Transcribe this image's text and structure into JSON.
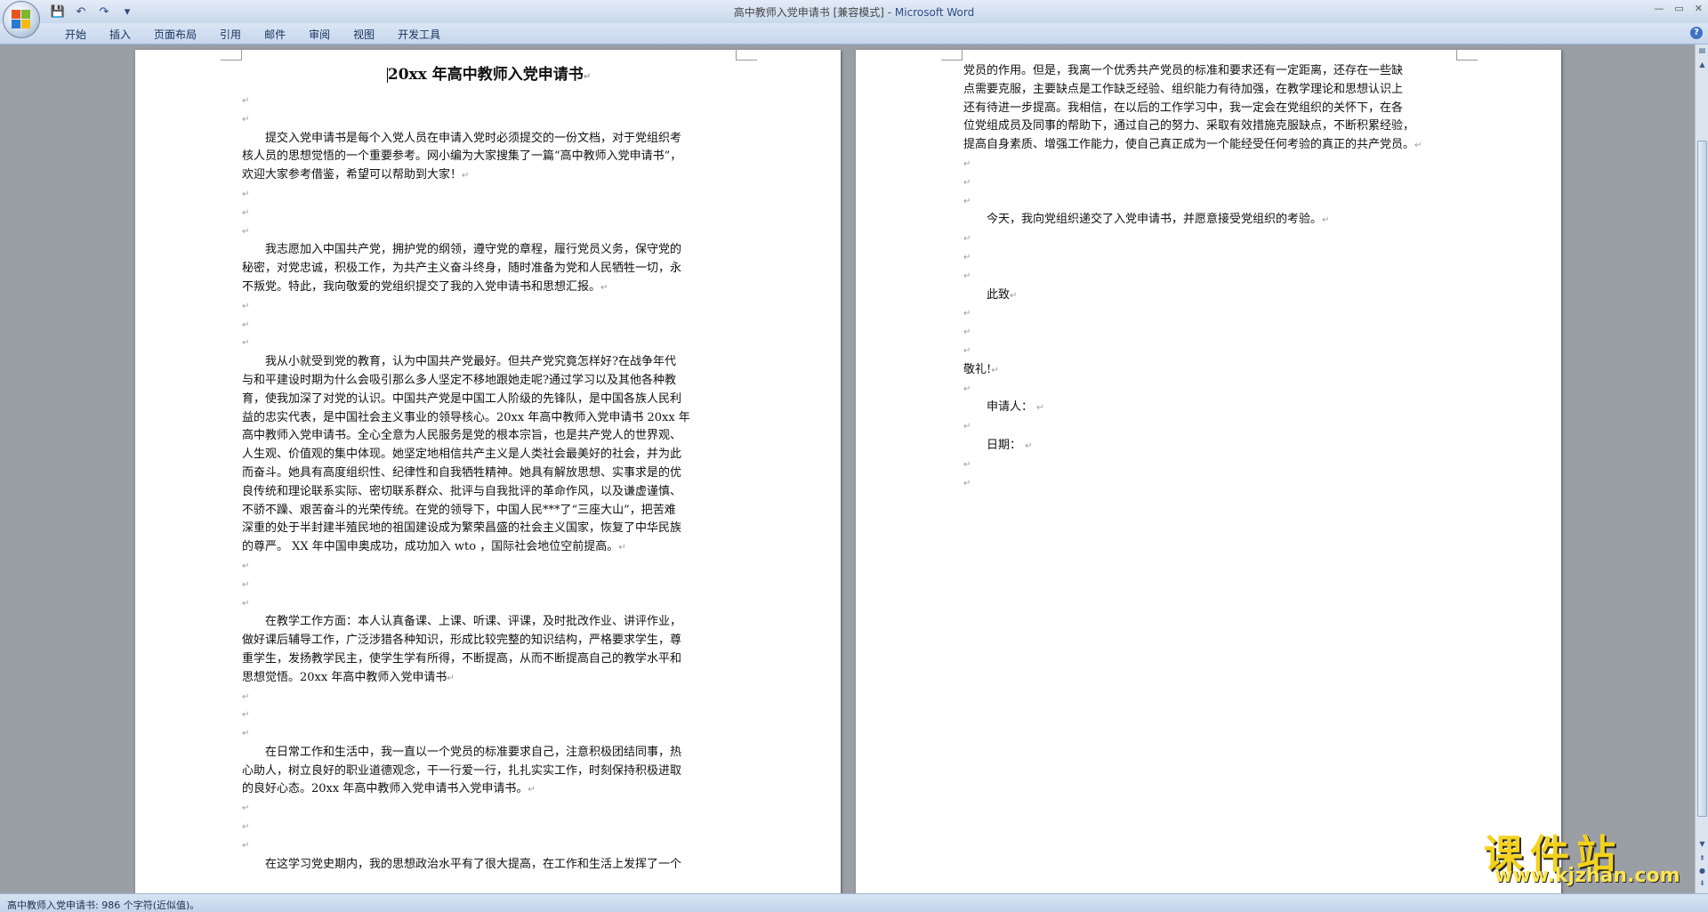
{
  "window": {
    "title": "高中教师入党申请书 [兼容模式] - ",
    "app_name": "Microsoft Word",
    "controls": [
      "—",
      "▭",
      "✕"
    ]
  },
  "quick_access": {
    "save": "💾",
    "undo": "↶",
    "redo": "↷",
    "customize": "▾"
  },
  "ribbon": {
    "tabs": [
      "开始",
      "插入",
      "页面布局",
      "引用",
      "邮件",
      "审阅",
      "视图",
      "开发工具"
    ],
    "help": "?"
  },
  "document": {
    "title": "20xx 年高中教师入党申请书",
    "pilcrow": "↵",
    "page1_paragraphs": [
      [
        "提交入党申请书是每个入党人员在申请入党时必须提交的一份文档，对于党组织考",
        "核人员的思想觉悟的一个重要参考。网小编为大家搜集了一篇“高中教师入党申请书”，",
        "欢迎大家参考借鉴，希望可以帮助到大家！"
      ],
      [
        "我志愿加入中国共产党，拥护党的纲领，遵守党的章程，履行党员义务，保守党的",
        "秘密，对党忠诚，积极工作，为共产主义奋斗终身，随时准备为党和人民牺牲一切，永",
        "不叛党。特此，我向敬爱的党组织提交了我的入党申请书和思想汇报。"
      ],
      [
        "我从小就受到党的教育，认为中国共产党最好。但共产党究竟怎样好?在战争年代",
        "与和平建设时期为什么会吸引那么多人坚定不移地跟她走呢?通过学习以及其他各种教",
        "育，使我加深了对党的认识。中国共产党是中国工人阶级的先锋队，是中国各族人民利",
        "益的忠实代表，是中国社会主义事业的领导核心。20xx 年高中教师入党申请书 20xx 年",
        "高中教师入党申请书。全心全意为人民服务是党的根本宗旨，也是共产党人的世界观、",
        "人生观、价值观的集中体现。她坚定地相信共产主义是人类社会最美好的社会，并为此",
        "而奋斗。她具有高度组织性、纪律性和自我牺牲精神。她具有解放思想、实事求是的优",
        "良传统和理论联系实际、密切联系群众、批评与自我批评的革命作风，以及谦虚谨慎、",
        "不骄不躁、艰苦奋斗的光荣传统。在党的领导下，中国人民***了“三座大山”，把苦难",
        "深重的处于半封建半殖民地的祖国建设成为繁荣昌盛的社会主义国家，恢复了中华民族",
        "的尊严。 XX 年中国申奥成功，成功加入 wto ，国际社会地位空前提高。"
      ],
      [
        "在教学工作方面：本人认真备课、上课、听课、评课，及时批改作业、讲评作业，",
        "做好课后辅导工作，广泛涉猎各种知识，形成比较完整的知识结构，严格要求学生，尊",
        "重学生，发扬教学民主，使学生学有所得，不断提高，从而不断提高自己的教学水平和",
        "思想觉悟。20xx 年高中教师入党申请书"
      ],
      [
        "在日常工作和生活中，我一直以一个党员的标准要求自己，注意积极团结同事，热",
        "心助人，树立良好的职业道德观念，干一行爱一行，扎扎实实工作，时刻保持积极进取",
        "的良好心态。20xx 年高中教师入党申请书入党申请书。"
      ],
      [
        "在这学习党史期内，我的思想政治水平有了很大提高，在工作和生活上发挥了一个"
      ]
    ],
    "page2_continuation": [
      "党员的作用。但是，我离一个优秀共产党员的标准和要求还有一定距离，还存在一些缺",
      "点需要克服，主要缺点是工作缺乏经验、组织能力有待加强，在教学理论和思想认识上",
      "还有待进一步提高。我相信，在以后的工作学习中，我一定会在党组织的关怀下，在各",
      "位党组成员及同事的帮助下，通过自己的努力、采取有效措施克服缺点，不断积累经验，",
      "提高自身素质、增强工作能力，使自己真正成为一个能经受任何考验的真正的共产党员。"
    ],
    "page2_submit": "今天，我向党组织递交了入党申请书，并愿意接受党组织的考验。",
    "page2_salute1": "此致",
    "page2_salute2": "敬礼!",
    "page2_applicant": "申请人：",
    "page2_date": "日期："
  },
  "statusbar": {
    "text": "高中教师入党申请书: 986 个字符(近似值)。"
  },
  "watermark": {
    "text": "课件站",
    "url": "www.kjzhan.com"
  },
  "colors": {
    "title_app": "#2d4d86",
    "ribbon_bg": "#c7d7ed",
    "doc_bg": "#9a9ea5"
  }
}
